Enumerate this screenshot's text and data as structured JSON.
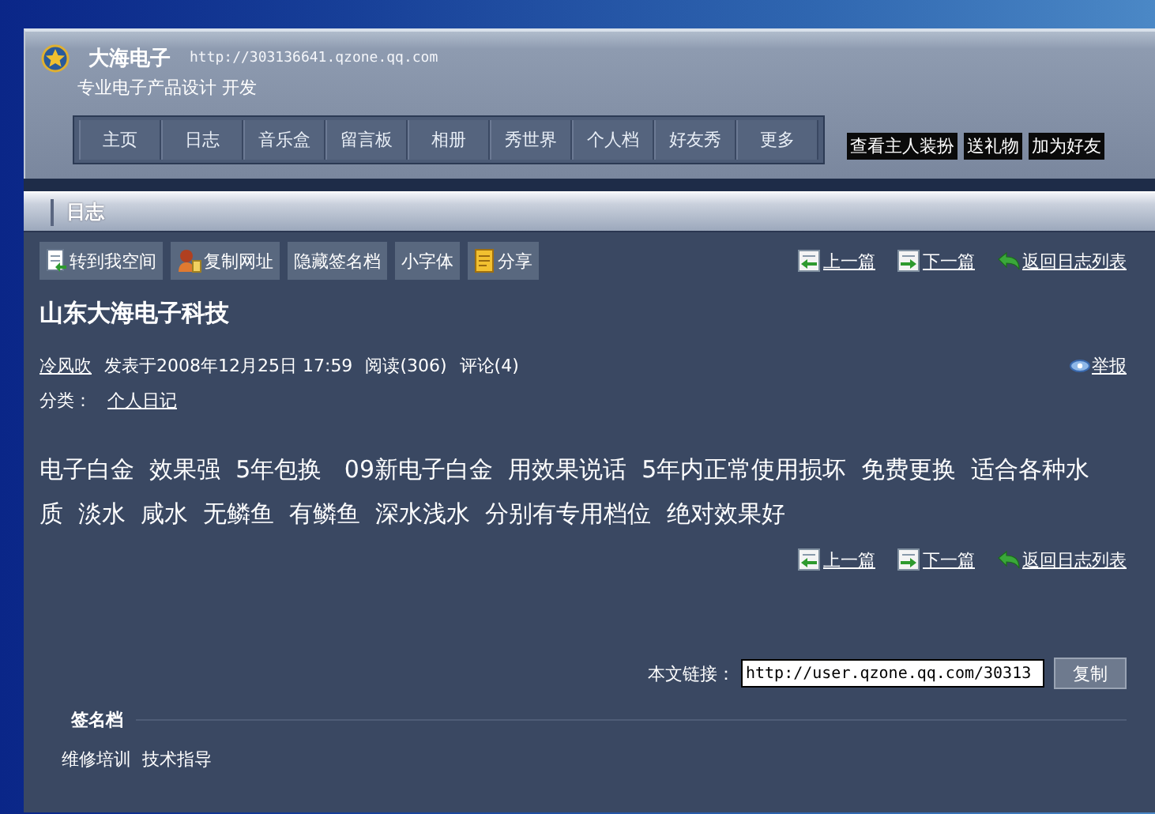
{
  "blog": {
    "name": "大海电子",
    "url": "http://303136641.qzone.qq.com",
    "tagline": "专业电子产品设计 开发"
  },
  "nav": [
    {
      "label": "主页"
    },
    {
      "label": "日志"
    },
    {
      "label": "音乐盒"
    },
    {
      "label": "留言板"
    },
    {
      "label": "相册"
    },
    {
      "label": "秀世界"
    },
    {
      "label": "个人档"
    },
    {
      "label": "好友秀"
    },
    {
      "label": "更多"
    }
  ],
  "header_actions": [
    "查看主人装扮",
    "送礼物",
    "加为好友"
  ],
  "section_title": "日志",
  "toolbar": [
    {
      "label": "转到我空间",
      "kind": "page"
    },
    {
      "label": "复制网址",
      "kind": "person"
    },
    {
      "label": "隐藏签名档",
      "kind": "plain"
    },
    {
      "label": "小字体",
      "kind": "plain"
    },
    {
      "label": "分享",
      "kind": "share"
    }
  ],
  "post_nav_top": [
    {
      "label": "上一篇",
      "kind": "prev"
    },
    {
      "label": "下一篇",
      "kind": "next"
    },
    {
      "label": "返回日志列表",
      "kind": "back"
    }
  ],
  "post": {
    "title": "山东大海电子科技",
    "author": "冷风吹",
    "date": "发表于2008年12月25日 17:59",
    "reads": "阅读(306)",
    "comments": "评论(4)",
    "report": "举报",
    "category_label": "分类：",
    "category": "个人日记",
    "body": "电子白金  效果强  5年包换   09新电子白金  用效果说话  5年内正常使用损坏  免费更换  适合各种水质  淡水  咸水  无鳞鱼  有鳞鱼  深水浅水  分别有专用档位  绝对效果好"
  },
  "post_nav_bottom": [
    {
      "label": "上一篇",
      "kind": "prev"
    },
    {
      "label": "下一篇",
      "kind": "next"
    },
    {
      "label": "返回日志列表",
      "kind": "back"
    }
  ],
  "link": {
    "label": "本文链接：",
    "value": "http://user.qzone.qq.com/30313",
    "button": "复制"
  },
  "signature": {
    "title": "签名档",
    "text": "维修培训  技术指导"
  }
}
